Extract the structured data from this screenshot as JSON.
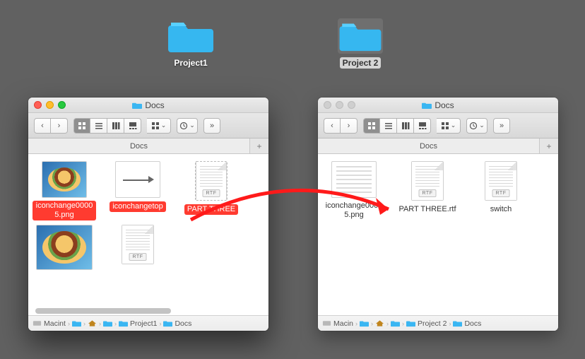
{
  "desktop": {
    "folders": [
      {
        "label": "Project1",
        "selected": false
      },
      {
        "label": "Project 2",
        "selected": true
      }
    ]
  },
  "leftWindow": {
    "title": "Docs",
    "tab": "Docs",
    "active": true,
    "items": [
      {
        "label": "iconchange00005.png",
        "kind": "image-burger",
        "selected": true
      },
      {
        "label": "iconchangetop",
        "kind": "image-arrow",
        "selected": true
      },
      {
        "label": "PART THREE",
        "kind": "rtf",
        "selected": true,
        "rtf_badge": "RTF",
        "cut": true
      },
      {
        "label": "",
        "kind": "image-burger",
        "selected": false
      },
      {
        "label": "",
        "kind": "rtf",
        "selected": false,
        "rtf_badge": "RTF"
      }
    ],
    "path": [
      "Macint",
      "_disk",
      "_folder",
      "_home",
      "_folder",
      "Project1",
      "Docs"
    ],
    "path_segments": [
      {
        "icon": "disk",
        "label": "Macint"
      },
      {
        "icon": "folder",
        "label": ""
      },
      {
        "icon": "home",
        "label": ""
      },
      {
        "icon": "folder",
        "label": ""
      },
      {
        "icon": "folder",
        "label": "Project1"
      },
      {
        "icon": "folder",
        "label": "Docs"
      }
    ]
  },
  "rightWindow": {
    "title": "Docs",
    "tab": "Docs",
    "active": false,
    "items": [
      {
        "label": "iconchange00005.png",
        "kind": "thumblist",
        "selected": false
      },
      {
        "label": "PART THREE.rtf",
        "kind": "rtf",
        "selected": false,
        "rtf_badge": "RTF"
      },
      {
        "label": "switch",
        "kind": "rtf",
        "selected": false,
        "rtf_badge": "RTF"
      }
    ],
    "path_segments": [
      {
        "icon": "disk",
        "label": "Macin"
      },
      {
        "icon": "folder",
        "label": ""
      },
      {
        "icon": "home",
        "label": ""
      },
      {
        "icon": "folder",
        "label": ""
      },
      {
        "icon": "folder",
        "label": "Project 2"
      },
      {
        "icon": "folder",
        "label": "Docs"
      }
    ]
  },
  "icons": {
    "chevron_left": "‹",
    "chevron_right": "›",
    "overflow": "»"
  }
}
